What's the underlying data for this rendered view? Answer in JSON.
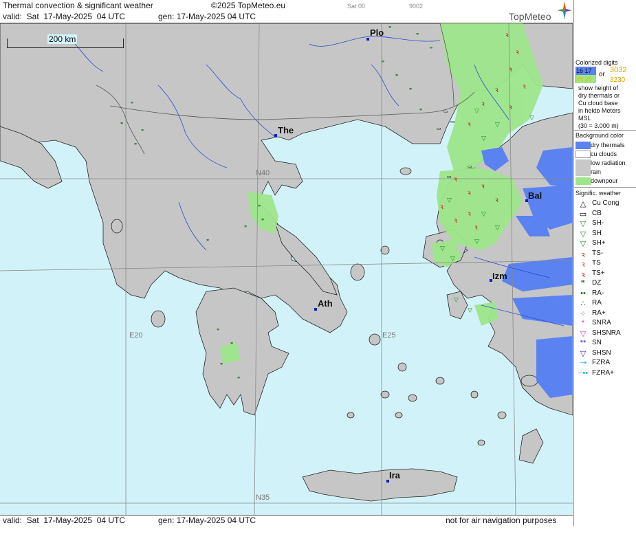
{
  "header": {
    "title": "Thermal convection & significant weather",
    "copyright": "©2025 TopMeteo.eu",
    "extra1": "Sat 00",
    "extra2": "9002",
    "valid": "valid:  Sat  17-May-2025  04 UTC",
    "gen": "gen: 17-May-2025 04 UTC"
  },
  "footer": {
    "valid": "valid:  Sat  17-May-2025  04 UTC",
    "gen": "gen: 17-May-2025 04 UTC",
    "note": "not for air navigation purposes"
  },
  "logo": "TopMeteo",
  "map": {
    "scale": "200 km",
    "cities": [
      {
        "label": "Plo"
      },
      {
        "label": "The"
      },
      {
        "label": "Bal"
      },
      {
        "label": "Izm"
      },
      {
        "label": "Ath"
      },
      {
        "label": "Ira"
      }
    ],
    "grid_labels": {
      "n40": "N40",
      "n35": "N35",
      "e20": "E20",
      "e25": "E25"
    }
  },
  "legend": {
    "digits_title": "Colorized digits",
    "digits_a1": "16 17",
    "digits_a2": "28 25",
    "digits_or": "or",
    "digits_b1": "3032",
    "digits_b2": "3230",
    "desc": [
      "show height of",
      "dry thermals or",
      "Cu cloud base",
      "in hekto Meters",
      "MSL",
      "(30 = 3.000 m)"
    ],
    "bg_title": "Background color",
    "bg_items": [
      {
        "label": "dry thermals",
        "color": "#5a82f0"
      },
      {
        "label": "cu clouds",
        "color": "#ffffff"
      },
      {
        "label": "low radiation",
        "color": "#c8c8c8"
      },
      {
        "label": "rain",
        "color": "#c8c8c8"
      },
      {
        "label": "downpour",
        "color": "#9ee68c"
      }
    ],
    "wx_title": "Signific. weather",
    "wx_items": [
      {
        "label": "Cu Cong",
        "symbol": "△",
        "color": "#000000"
      },
      {
        "label": "CB",
        "symbol": "▭",
        "color": "#000000"
      },
      {
        "label": "SH-",
        "symbol": "▽",
        "color": "#1a8a1a"
      },
      {
        "label": "SH",
        "symbol": "▽",
        "color": "#1a8a1a"
      },
      {
        "label": "SH+",
        "symbol": "▽",
        "color": "#1a8a1a"
      },
      {
        "label": "TS-",
        "symbol": "ꝛ",
        "color": "#cc1111"
      },
      {
        "label": "TS",
        "symbol": "ꝛ",
        "color": "#cc1111"
      },
      {
        "label": "TS+",
        "symbol": "ꝛ",
        "color": "#cc1111"
      },
      {
        "label": "DZ",
        "symbol": "❞",
        "color": "#1a6a1a"
      },
      {
        "label": "RA-",
        "symbol": "••",
        "color": "#1a6a1a"
      },
      {
        "label": "RA",
        "symbol": "∴",
        "color": "#1a6a1a"
      },
      {
        "label": "RA+",
        "symbol": "⁘",
        "color": "#1a6a1a"
      },
      {
        "label": "SNRA",
        "symbol": "*",
        "color": "#cc33cc"
      },
      {
        "label": "SHSNRA",
        "symbol": "▽",
        "color": "#cc33cc"
      },
      {
        "label": "SN",
        "symbol": "**",
        "color": "#2222cc"
      },
      {
        "label": "SHSN",
        "symbol": "▽",
        "color": "#2222cc"
      },
      {
        "label": "FZRA",
        "symbol": "~•",
        "color": "#22bbcc"
      },
      {
        "label": "FZRA+",
        "symbol": "~••",
        "color": "#22bbcc"
      }
    ]
  }
}
